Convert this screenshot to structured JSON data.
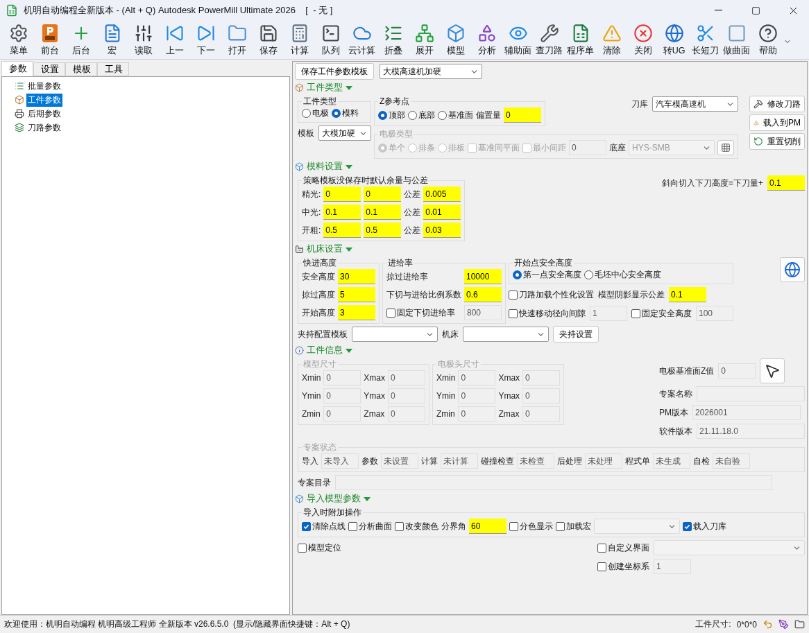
{
  "window": {
    "title": "机明自动编程全新版本 - (Alt + Q) Autodesk PowerMill Ultimate 2026    [  - 无 ]"
  },
  "toolbar": [
    {
      "label": "菜单"
    },
    {
      "label": "前台"
    },
    {
      "label": "后台"
    },
    {
      "label": "宏"
    },
    {
      "label": "读取"
    },
    {
      "label": "上一"
    },
    {
      "label": "下一"
    },
    {
      "label": "打开"
    },
    {
      "label": "保存"
    },
    {
      "label": "计算"
    },
    {
      "label": "队列"
    },
    {
      "label": "云计算"
    },
    {
      "label": "折叠"
    },
    {
      "label": "展开"
    },
    {
      "label": "模型"
    },
    {
      "label": "分析"
    },
    {
      "label": "辅助面"
    },
    {
      "label": "查刀路"
    },
    {
      "label": "程序单"
    },
    {
      "label": "清除"
    },
    {
      "label": "关闭"
    },
    {
      "label": "转UG"
    },
    {
      "label": "长短刀"
    },
    {
      "label": "做曲面"
    },
    {
      "label": "帮助"
    }
  ],
  "left_tabs": [
    {
      "label": "参数",
      "selected": true
    },
    {
      "label": "设置",
      "selected": false
    },
    {
      "label": "模板",
      "selected": false
    },
    {
      "label": "工具",
      "selected": false
    }
  ],
  "tree": [
    {
      "label": "批量参数",
      "selected": false
    },
    {
      "label": "工件参数",
      "selected": true
    },
    {
      "label": "后期参数",
      "selected": false
    },
    {
      "label": "刀路参数",
      "selected": false
    }
  ],
  "top_bar": {
    "button": "保存工件参数模板",
    "template": "大模高速机加硬"
  },
  "sections": [
    {
      "title": "工件类型",
      "expanded": true,
      "blocks": [
        {
          "kind": "columns",
          "columns": [
            [
              {
                "kind": "group",
                "legend": "工件类型",
                "disabled": false,
                "rows": [
                  [
                    {
                      "kind": "radio",
                      "text": "电极",
                      "selected": false
                    },
                    {
                      "kind": "radio",
                      "text": "模料",
                      "selected": true
                    }
                  ]
                ]
              },
              {
                "kind": "row",
                "items": [
                  {
                    "kind": "text",
                    "text": "模板"
                  },
                  {
                    "kind": "combo",
                    "value": "大模加硬"
                  }
                ]
              }
            ],
            [
              {
                "kind": "columns",
                "columns": [
                  [
                    {
                      "kind": "group",
                      "legend": "Z参考点",
                      "disabled": false,
                      "rows": [
                        [
                          {
                            "kind": "radio",
                            "text": "顶部",
                            "selected": true
                          },
                          {
                            "kind": "radio",
                            "text": "底部",
                            "selected": false
                          },
                          {
                            "kind": "radio",
                            "text": "基准面",
                            "selected": false
                          },
                          {
                            "kind": "text",
                            "text": "偏置量"
                          },
                          {
                            "kind": "field",
                            "value": "0",
                            "disabled": false
                          }
                        ]
                      ]
                    }
                  ],
                  [
                    {
                      "kind": "row",
                      "items": [
                        {
                          "kind": "text",
                          "text": "刀库"
                        },
                        {
                          "kind": "combo",
                          "value": "汽车模高速机"
                        }
                      ]
                    }
                  ]
                ]
              },
              {
                "kind": "group",
                "legend": "电极类型",
                "disabled": true,
                "rows": [
                  [
                    {
                      "kind": "radio",
                      "text": "单个",
                      "selected": true,
                      "disabled": true
                    },
                    {
                      "kind": "radio",
                      "text": "排条",
                      "selected": false,
                      "disabled": true
                    },
                    {
                      "kind": "radio",
                      "text": "排板",
                      "selected": false,
                      "disabled": true
                    },
                    {
                      "kind": "check",
                      "text": "基准同平面",
                      "checked": false,
                      "disabled": true
                    },
                    {
                      "kind": "check",
                      "text": "最小间距",
                      "checked": false,
                      "disabled": true
                    },
                    {
                      "kind": "field",
                      "value": "0",
                      "disabled": true
                    },
                    {
                      "kind": "text",
                      "text": "底座"
                    },
                    {
                      "kind": "combo",
                      "value": "HYS-SMB",
                      "disabled": true
                    },
                    {
                      "kind": "icon_button"
                    }
                  ]
                ]
              }
            ],
            [
              {
                "kind": "row",
                "items": [
                  {
                    "kind": "icon_text_button",
                    "text": "修改刀路"
                  }
                ]
              },
              {
                "kind": "row",
                "items": [
                  {
                    "kind": "icon_text_button",
                    "text": "载入到PM"
                  }
                ]
              },
              {
                "kind": "row",
                "items": [
                  {
                    "kind": "icon_text_button",
                    "text": "重置切削"
                  }
                ]
              }
            ]
          ]
        }
      ]
    },
    {
      "title": "模料设置",
      "expanded": true,
      "blocks": [
        {
          "kind": "columns",
          "columns": [
            [
              {
                "kind": "group",
                "legend": "策略模板没保存时默认余量与公差",
                "disabled": false,
                "rows": [
                  [
                    {
                      "kind": "text",
                      "text": "精光:"
                    },
                    {
                      "kind": "field",
                      "value": "0",
                      "disabled": false
                    },
                    {
                      "kind": "field",
                      "value": "0",
                      "disabled": false
                    },
                    {
                      "kind": "text",
                      "text": "公差"
                    },
                    {
                      "kind": "field",
                      "value": "0.005",
                      "disabled": false
                    }
                  ],
                  [
                    {
                      "kind": "text",
                      "text": "中光:"
                    },
                    {
                      "kind": "field",
                      "value": "0.1",
                      "disabled": false
                    },
                    {
                      "kind": "field",
                      "value": "0.1",
                      "disabled": false
                    },
                    {
                      "kind": "text",
                      "text": "公差"
                    },
                    {
                      "kind": "field",
                      "value": "0.01",
                      "disabled": false
                    }
                  ],
                  [
                    {
                      "kind": "text",
                      "text": "开粗:"
                    },
                    {
                      "kind": "field",
                      "value": "0.5",
                      "disabled": false
                    },
                    {
                      "kind": "field",
                      "value": "0.5",
                      "disabled": false
                    },
                    {
                      "kind": "text",
                      "text": "公差"
                    },
                    {
                      "kind": "field",
                      "value": "0.03",
                      "disabled": false
                    }
                  ]
                ]
              }
            ],
            [
              {
                "kind": "row",
                "items": [
                  {
                    "kind": "text",
                    "text": "斜向切入下刀高度=下刀量+"
                  },
                  {
                    "kind": "field",
                    "value": "0.1",
                    "disabled": false
                  }
                ]
              }
            ]
          ]
        }
      ]
    },
    {
      "title": "机床设置",
      "expanded": true,
      "blocks": [
        {
          "kind": "columns",
          "columns": [
            [
              {
                "kind": "group",
                "legend": "快进高度",
                "disabled": false,
                "rows": [
                  [
                    {
                      "kind": "text",
                      "text": "安全高度"
                    },
                    {
                      "kind": "field",
                      "value": "30",
                      "disabled": false
                    }
                  ],
                  [
                    {
                      "kind": "text",
                      "text": "掠过高度"
                    },
                    {
                      "kind": "field",
                      "value": "5",
                      "disabled": false
                    }
                  ],
                  [
                    {
                      "kind": "text",
                      "text": "开始高度"
                    },
                    {
                      "kind": "field",
                      "value": "3",
                      "disabled": false
                    }
                  ]
                ]
              }
            ],
            [
              {
                "kind": "group",
                "legend": "进给率",
                "disabled": false,
                "rows": [
                  [
                    {
                      "kind": "text",
                      "text": "掠过进给率"
                    },
                    {
                      "kind": "field",
                      "value": "10000",
                      "disabled": false
                    }
                  ],
                  [
                    {
                      "kind": "text",
                      "text": "下切与进给比例系数"
                    },
                    {
                      "kind": "field",
                      "value": "0.6",
                      "disabled": false
                    }
                  ],
                  [
                    {
                      "kind": "check",
                      "text": "固定下切进给率",
                      "checked": false
                    },
                    {
                      "kind": "field",
                      "value": "800",
                      "disabled": true
                    }
                  ]
                ]
              }
            ],
            [
              {
                "kind": "group",
                "legend": "开始点安全高度",
                "disabled": false,
                "rows": [
                  [
                    {
                      "kind": "radio",
                      "text": "第一点安全高度",
                      "selected": true
                    },
                    {
                      "kind": "radio",
                      "text": "毛坯中心安全高度",
                      "selected": false
                    }
                  ]
                ]
              },
              {
                "kind": "row",
                "items": [
                  {
                    "kind": "check",
                    "text": "刀路加载个性化设置",
                    "checked": false
                  },
                  {
                    "kind": "text",
                    "text": "模型阴影显示公差"
                  },
                  {
                    "kind": "field",
                    "value": "0.1",
                    "disabled": false
                  }
                ]
              },
              {
                "kind": "row",
                "items": [
                  {
                    "kind": "check",
                    "text": "快速移动径向间隙",
                    "checked": false
                  },
                  {
                    "kind": "field",
                    "value": "1",
                    "disabled": true
                  },
                  {
                    "kind": "check",
                    "text": "固定安全高度",
                    "checked": false
                  },
                  {
                    "kind": "field",
                    "value": "100",
                    "disabled": true
                  }
                ]
              }
            ],
            [
              {
                "kind": "row",
                "items": [
                  {
                    "kind": "icon_button"
                  }
                ]
              }
            ]
          ]
        },
        {
          "kind": "row",
          "items": [
            {
              "kind": "text",
              "text": "夹持配置模板"
            },
            {
              "kind": "combo"
            },
            {
              "kind": "text",
              "text": "机床"
            },
            {
              "kind": "combo"
            },
            {
              "kind": "button",
              "text": "夹持设置"
            }
          ]
        }
      ]
    },
    {
      "title": "工件信息",
      "expanded": true,
      "blocks": [
        {
          "kind": "columns",
          "columns": [
            [
              {
                "kind": "group",
                "legend": "模型尺寸",
                "disabled": true,
                "rows": [
                  [
                    {
                      "kind": "text",
                      "text": "Xmin"
                    },
                    {
                      "kind": "field",
                      "value": "0",
                      "disabled": true
                    },
                    {
                      "kind": "text",
                      "text": "Xmax"
                    },
                    {
                      "kind": "field",
                      "value": "0",
                      "disabled": true
                    }
                  ],
                  [
                    {
                      "kind": "text",
                      "text": "Ymin"
                    },
                    {
                      "kind": "field",
                      "value": "0",
                      "disabled": true
                    },
                    {
                      "kind": "text",
                      "text": "Ymax"
                    },
                    {
                      "kind": "field",
                      "value": "0",
                      "disabled": true
                    }
                  ],
                  [
                    {
                      "kind": "text",
                      "text": "Zmin"
                    },
                    {
                      "kind": "field",
                      "value": "0",
                      "disabled": true
                    },
                    {
                      "kind": "text",
                      "text": "Zmax"
                    },
                    {
                      "kind": "field",
                      "value": "0",
                      "disabled": true
                    }
                  ]
                ]
              }
            ],
            [
              {
                "kind": "group",
                "legend": "电极头尺寸",
                "disabled": true,
                "rows": [
                  [
                    {
                      "kind": "text",
                      "text": "Xmin"
                    },
                    {
                      "kind": "field",
                      "value": "0",
                      "disabled": true
                    },
                    {
                      "kind": "text",
                      "text": "Xmax"
                    },
                    {
                      "kind": "field",
                      "value": "0",
                      "disabled": true
                    }
                  ],
                  [
                    {
                      "kind": "text",
                      "text": "Ymin"
                    },
                    {
                      "kind": "field",
                      "value": "0",
                      "disabled": true
                    },
                    {
                      "kind": "text",
                      "text": "Ymax"
                    },
                    {
                      "kind": "field",
                      "value": "0",
                      "disabled": true
                    }
                  ],
                  [
                    {
                      "kind": "text",
                      "text": "Zmin"
                    },
                    {
                      "kind": "field",
                      "value": "0",
                      "disabled": true
                    },
                    {
                      "kind": "text",
                      "text": "Zmax"
                    },
                    {
                      "kind": "field",
                      "value": "0",
                      "disabled": true
                    }
                  ]
                ]
              }
            ],
            [
              {
                "kind": "row",
                "items": [
                  {
                    "kind": "text",
                    "text": "电极基准面Z值"
                  },
                  {
                    "kind": "field",
                    "value": "0",
                    "disabled": true
                  },
                  {
                    "kind": "icon_button"
                  }
                ]
              },
              {
                "kind": "row",
                "items": [
                  {
                    "kind": "text",
                    "text": "专案名称"
                  },
                  {
                    "kind": "long_field",
                    "disabled": true
                  }
                ]
              },
              {
                "kind": "row",
                "items": [
                  {
                    "kind": "text",
                    "text": "PM版本"
                  },
                  {
                    "kind": "long_field",
                    "value": "2026001",
                    "disabled": true
                  }
                ]
              },
              {
                "kind": "row",
                "items": [
                  {
                    "kind": "text",
                    "text": "软件版本"
                  },
                  {
                    "kind": "long_field",
                    "value": "21.11.18.0",
                    "disabled": true
                  }
                ]
              }
            ]
          ]
        },
        {
          "kind": "group",
          "legend": "专案状态",
          "disabled": true,
          "rows": [
            [
              {
                "kind": "text",
                "text": "导入"
              },
              {
                "kind": "field",
                "value": "未导入",
                "disabled": true
              },
              {
                "kind": "text",
                "text": "参数"
              },
              {
                "kind": "field",
                "value": "未设置",
                "disabled": true
              },
              {
                "kind": "text",
                "text": "计算"
              },
              {
                "kind": "field",
                "value": "未计算",
                "disabled": true
              },
              {
                "kind": "text",
                "text": "碰撞检查"
              },
              {
                "kind": "field",
                "value": "未检查",
                "disabled": true
              },
              {
                "kind": "text",
                "text": "后处理"
              },
              {
                "kind": "field",
                "value": "未处理",
                "disabled": true
              },
              {
                "kind": "text",
                "text": "程式单"
              },
              {
                "kind": "field",
                "value": "未生成",
                "disabled": true
              },
              {
                "kind": "text",
                "text": "自检"
              },
              {
                "kind": "field",
                "value": "未自验",
                "disabled": true
              }
            ]
          ]
        },
        {
          "kind": "row",
          "items": [
            {
              "kind": "text",
              "text": "专案目录"
            },
            {
              "kind": "wide_field",
              "disabled": true
            }
          ]
        }
      ]
    },
    {
      "title": "导入模型参数",
      "expanded": true,
      "blocks": [
        {
          "kind": "group",
          "legend": "导入时附加操作",
          "disabled": false,
          "rows": [
            [
              {
                "kind": "check",
                "text": "清除点线",
                "checked": true
              },
              {
                "kind": "check",
                "text": "分析曲面",
                "checked": false
              },
              {
                "kind": "check",
                "text": "改变颜色",
                "checked": false
              },
              {
                "kind": "text",
                "text": "分界角"
              },
              {
                "kind": "field",
                "value": "60",
                "disabled": false
              },
              {
                "kind": "check",
                "text": "分色显示",
                "checked": false
              },
              {
                "kind": "check",
                "text": "加载宏",
                "checked": false
              },
              {
                "kind": "combo",
                "disabled": true
              },
              {
                "kind": "check",
                "text": "载入刀库",
                "checked": true
              }
            ]
          ]
        },
        {
          "kind": "columns",
          "columns": [
            [
              {
                "kind": "row",
                "items": [
                  {
                    "kind": "check",
                    "text": "模型定位",
                    "checked": false
                  }
                ]
              }
            ],
            [
              {
                "kind": "row",
                "items": [
                  {
                    "kind": "check",
                    "text": "自定义界面",
                    "checked": false
                  },
                  {
                    "kind": "long_combo",
                    "disabled": true
                  }
                ]
              },
              {
                "kind": "row",
                "items": [
                  {
                    "kind": "check",
                    "text": "创建坐标系",
                    "checked": false
                  },
                  {
                    "kind": "field",
                    "value": "1",
                    "disabled": true
                  }
                ]
              }
            ]
          ]
        }
      ]
    }
  ],
  "status_bar": {
    "message": "欢迎使用：机明自动编程 机明高级工程师 全新版本 v26.6.5.0  (显示/隐藏界面快捷键：Alt + Q)",
    "size_label": "工件尺寸:",
    "size_value": "0*0*0"
  }
}
